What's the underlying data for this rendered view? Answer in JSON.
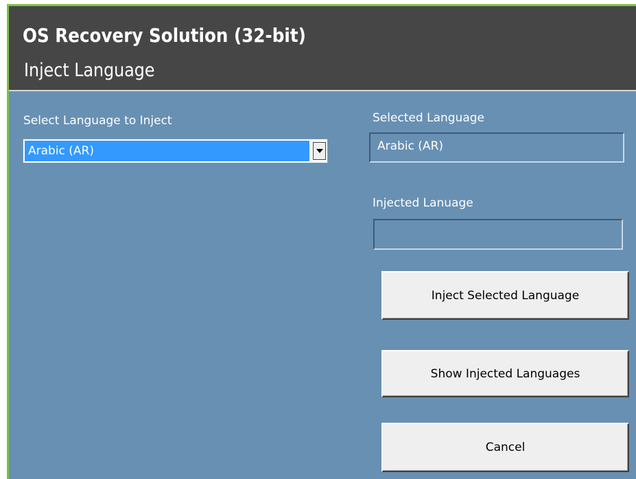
{
  "app": {
    "title": "OS Recovery Solution (32-bit)",
    "page_title": "Inject Language"
  },
  "left_panel": {
    "select_label": "Select Language to Inject",
    "select_value": "Arabic (AR)"
  },
  "right_panel": {
    "selected_label": "Selected Language",
    "selected_value": "Arabic (AR)",
    "injected_label": "Injected Lanuage",
    "injected_value": ""
  },
  "buttons": {
    "inject": "Inject Selected Language",
    "show": "Show Injected Languages",
    "cancel": "Cancel"
  },
  "icons": {
    "dropdown": "dropdown-arrow-icon"
  },
  "colors": {
    "background": "#6890b3",
    "header": "#464646",
    "accent": "#7cc242",
    "selection": "#3399ff"
  }
}
